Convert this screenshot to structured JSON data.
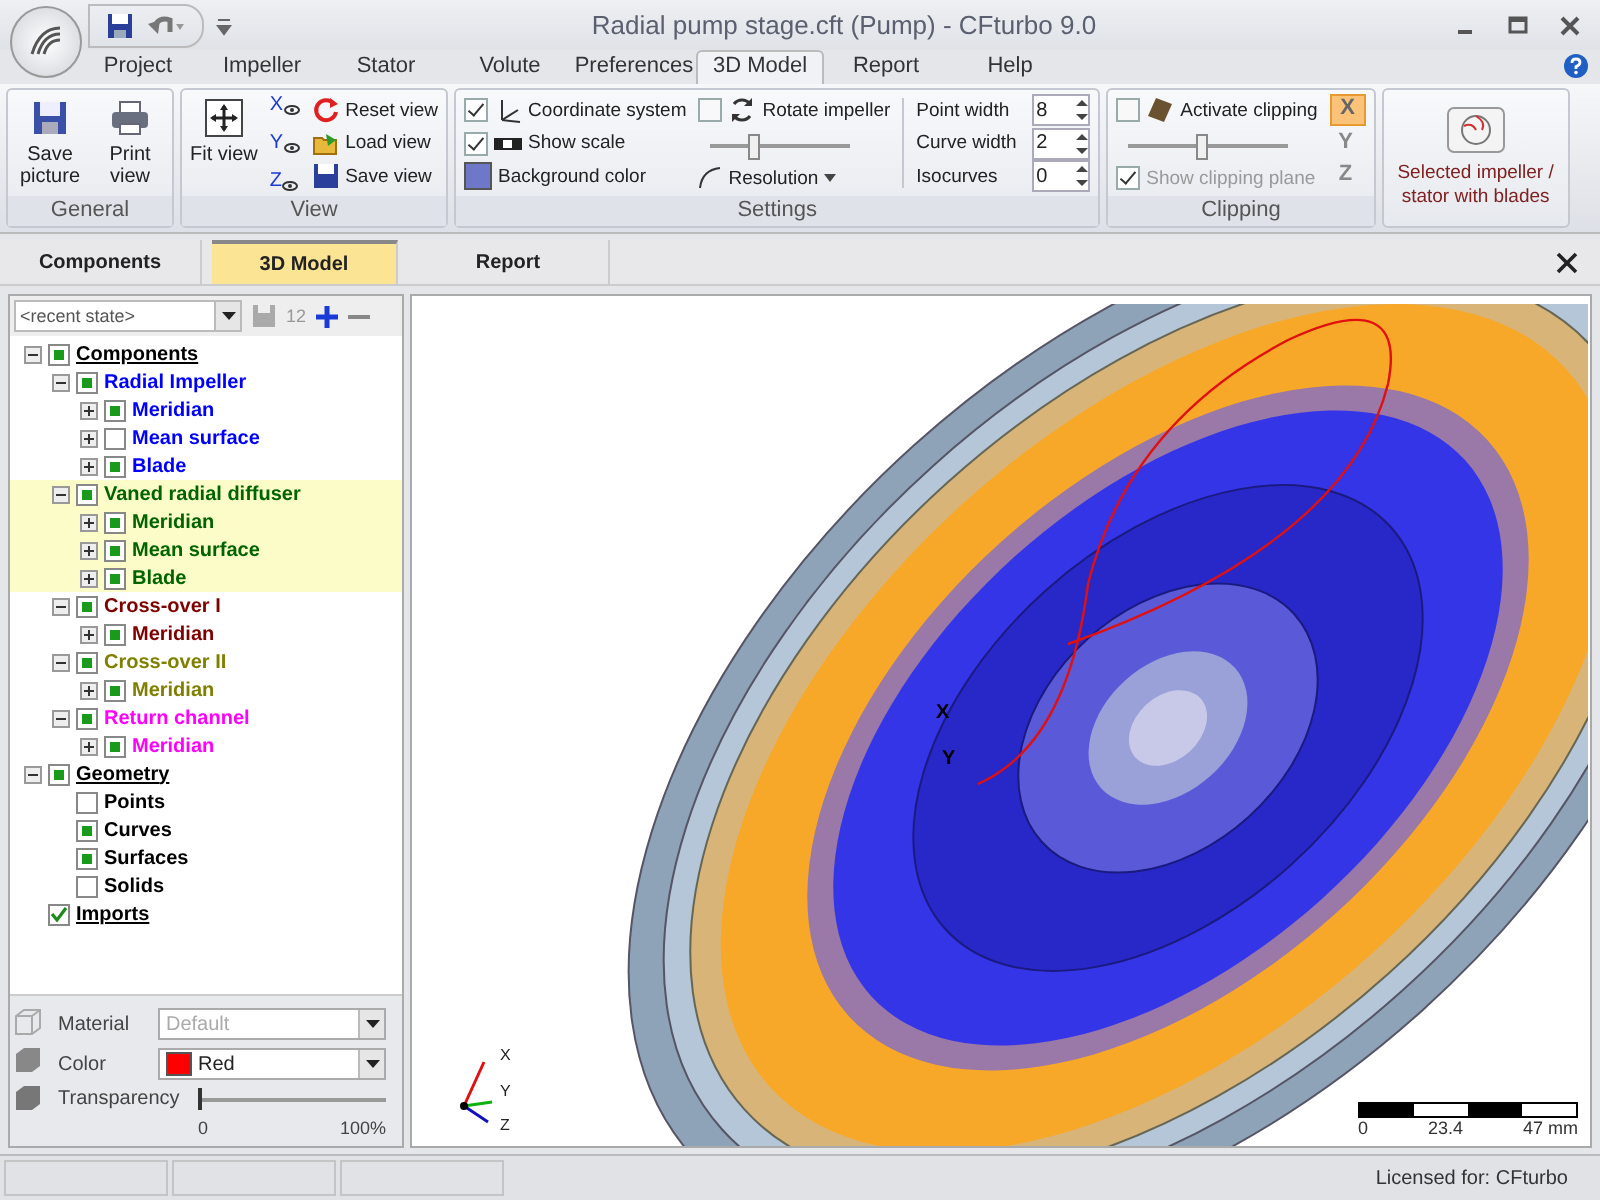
{
  "window": {
    "title": "Radial pump stage.cft (Pump) - CFturbo 9.0"
  },
  "ribbon_tabs": [
    {
      "label": "Project",
      "selected": false
    },
    {
      "label": "Impeller",
      "selected": false
    },
    {
      "label": "Stator",
      "selected": false
    },
    {
      "label": "Volute",
      "selected": false
    },
    {
      "label": "Preferences",
      "selected": false
    },
    {
      "label": "3D Model",
      "selected": true
    },
    {
      "label": "Report",
      "selected": false
    },
    {
      "label": "Help",
      "selected": false
    }
  ],
  "general": {
    "label": "General",
    "buttons": [
      {
        "label": "Save picture",
        "kind": "save"
      },
      {
        "label": "Print view",
        "kind": "print"
      }
    ]
  },
  "view": {
    "label": "View",
    "fit": "Fit view",
    "axis_buttons": [
      "X",
      "Y",
      "Z"
    ],
    "buttons": [
      {
        "label": "Reset view",
        "kind": "reset"
      },
      {
        "label": "Load view",
        "kind": "load"
      },
      {
        "label": "Save view",
        "kind": "save"
      }
    ]
  },
  "settings": {
    "label": "Settings",
    "coordinate_system": {
      "label": "Coordinate system",
      "checked": true
    },
    "show_scale": {
      "label": "Show scale",
      "checked": true
    },
    "background_color": "Background color",
    "rotate_impeller": {
      "label": "Rotate impeller",
      "checked": false
    },
    "speed": {
      "level": 0.3
    },
    "resolution": "Resolution",
    "spinners": [
      {
        "label": "Point width",
        "value": "8"
      },
      {
        "label": "Curve width",
        "value": "2"
      },
      {
        "label": "Isocurves",
        "value": "0"
      }
    ]
  },
  "clipping": {
    "label": "Clipping",
    "activate": {
      "label": "Activate clipping",
      "checked": false
    },
    "position": {
      "level": 0.45
    },
    "show_plane": {
      "label": "Show clipping plane",
      "checked": true,
      "disabled": true
    },
    "axes": [
      {
        "label": "X",
        "selected": true
      },
      {
        "label": "Y",
        "selected": false
      },
      {
        "label": "Z",
        "selected": false
      }
    ]
  },
  "selection_button": {
    "label": "Selected impeller / stator with blades"
  },
  "panel_tabs": [
    {
      "label": "Components",
      "selected": false
    },
    {
      "label": "3D Model",
      "selected": true
    },
    {
      "label": "Report",
      "selected": false
    }
  ],
  "recent_state": {
    "value": "<recent state>",
    "rename": "12"
  },
  "tree": [
    {
      "label": "Components",
      "kind": "group",
      "checked": true,
      "expanded": true,
      "selected": false,
      "color": "#000000",
      "children": [
        {
          "label": "Radial Impeller",
          "checked": true,
          "expanded": true,
          "selected": false,
          "color": "#0000ff",
          "children": [
            {
              "label": "Meridian",
              "checked": true,
              "expanded": false,
              "selected": false,
              "color": "#0000ff"
            },
            {
              "label": "Mean surface",
              "checked": false,
              "expanded": false,
              "selected": false,
              "color": "#0000ff"
            },
            {
              "label": "Blade",
              "checked": true,
              "expanded": false,
              "selected": false,
              "color": "#0000ff"
            }
          ]
        },
        {
          "label": "Vaned radial diffuser",
          "checked": true,
          "expanded": true,
          "selected": true,
          "color": "#006400",
          "children": [
            {
              "label": "Meridian",
              "checked": true,
              "expanded": false,
              "selected": true,
              "color": "#006400"
            },
            {
              "label": "Mean surface",
              "checked": true,
              "expanded": false,
              "selected": true,
              "color": "#006400"
            },
            {
              "label": "Blade",
              "checked": true,
              "expanded": false,
              "selected": true,
              "color": "#006400"
            }
          ]
        },
        {
          "label": "Cross-over I",
          "checked": true,
          "expanded": true,
          "selected": false,
          "color": "#800000",
          "children": [
            {
              "label": "Meridian",
              "checked": true,
              "expanded": false,
              "selected": false,
              "color": "#800000"
            }
          ]
        },
        {
          "label": "Cross-over II",
          "checked": true,
          "expanded": true,
          "selected": false,
          "color": "#808000",
          "children": [
            {
              "label": "Meridian",
              "checked": true,
              "expanded": false,
              "selected": false,
              "color": "#808000"
            }
          ]
        },
        {
          "label": "Return channel",
          "checked": true,
          "expanded": true,
          "selected": false,
          "color": "#ff00ff",
          "children": [
            {
              "label": "Meridian",
              "checked": true,
              "expanded": false,
              "selected": false,
              "color": "#ff00ff"
            }
          ]
        }
      ]
    },
    {
      "label": "Geometry",
      "kind": "group",
      "checked": true,
      "expanded": true,
      "selected": false,
      "color": "#000000",
      "children": [
        {
          "label": "Points",
          "checked": false,
          "selected": false,
          "color": "#000000"
        },
        {
          "label": "Curves",
          "checked": true,
          "selected": false,
          "color": "#000000"
        },
        {
          "label": "Surfaces",
          "checked": true,
          "selected": false,
          "color": "#000000"
        },
        {
          "label": "Solids",
          "checked": false,
          "selected": false,
          "color": "#000000"
        }
      ]
    },
    {
      "label": "Imports",
      "kind": "imports",
      "checked": true,
      "selected": false,
      "color": "#000000"
    }
  ],
  "properties": {
    "material": {
      "label": "Material",
      "value": "Default",
      "disabled": true
    },
    "color": {
      "label": "Color",
      "value": "Red",
      "color": "#ff0000"
    },
    "transparency": {
      "label": "Transparency",
      "level": 0,
      "min": "0",
      "max": "100%"
    }
  },
  "viewport": {
    "model_labels": [
      "X",
      "Y"
    ],
    "triad": [
      "X",
      "Y",
      "Z"
    ],
    "scale": [
      "0",
      "23.4",
      "47 mm"
    ]
  },
  "status_bar": {
    "license": "Licensed for: CFturbo"
  }
}
